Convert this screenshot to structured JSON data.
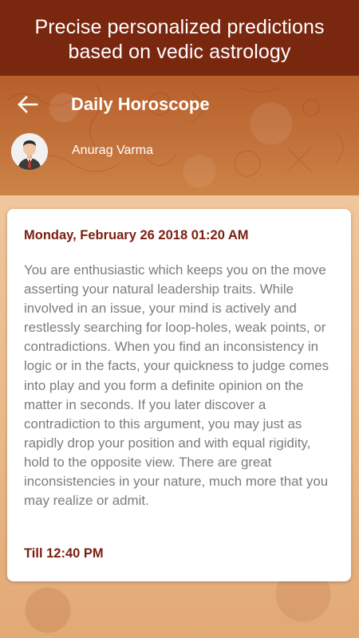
{
  "promo": {
    "line1": "Precise personalized predictions",
    "line2": "based on vedic astrology"
  },
  "header": {
    "title": "Daily Horoscope",
    "back_icon": "arrow-left-icon"
  },
  "user": {
    "name": "Anurag Varma",
    "avatar_icon": "user-avatar"
  },
  "horoscope": {
    "datetime": "Monday, February 26 2018 01:20 AM",
    "text": "You are enthusiastic which keeps you on the move asserting your natural leadership traits. While involved in an issue, your mind is actively and restlessly searching for loop-holes, weak points, or contradictions. When you find an inconsistency in logic or in the facts, your quickness to judge comes into play and you form a definite opinion on the matter in seconds. If you later discover a contradiction to this argument, you may just as rapidly drop your position and with equal rigidity, hold to the opposite view. There are great inconsistencies in your nature, much more that you may realize or admit.",
    "till": "Till 12:40 PM"
  },
  "colors": {
    "banner": "#7a2710",
    "accent_text": "#7a1f10",
    "body_text": "#7c7c7c",
    "header_bg": "#c2713a",
    "page_bg": "#eab887"
  }
}
